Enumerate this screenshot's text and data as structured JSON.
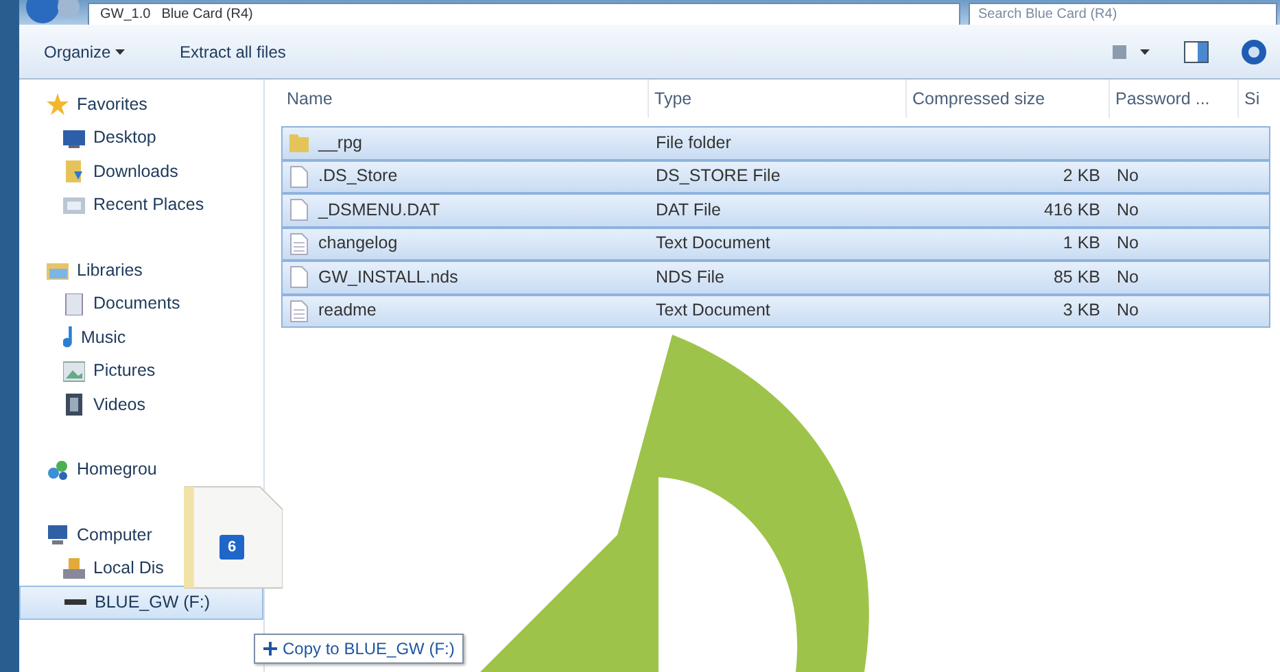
{
  "address_bar": {
    "crumbs": [
      "GW_1.0",
      "Blue Card (R4)"
    ],
    "search_placeholder": "Search Blue Card (R4)"
  },
  "toolbar": {
    "buttons": [
      {
        "label": "Organize",
        "dropdown": true
      },
      {
        "label": "Extract all files",
        "dropdown": false
      }
    ]
  },
  "sidebar": {
    "groups": [
      {
        "label": "Favorites",
        "selected": false,
        "children": [
          {
            "label": "Desktop",
            "selected": false
          },
          {
            "label": "Downloads",
            "selected": false
          },
          {
            "label": "Recent Places",
            "selected": false
          }
        ]
      },
      {
        "label": "Libraries",
        "selected": false,
        "children": [
          {
            "label": "Documents",
            "selected": false
          },
          {
            "label": "Music",
            "selected": false
          },
          {
            "label": "Pictures",
            "selected": false
          },
          {
            "label": "Videos",
            "selected": false
          }
        ]
      },
      {
        "label": "Homegrou",
        "selected": false
      },
      {
        "label": "Computer",
        "selected": false,
        "children": [
          {
            "label": "Local Dis",
            "selected": false
          },
          {
            "label": "BLUE_GW (F:)",
            "selected": true
          }
        ]
      }
    ]
  },
  "table": {
    "columns": [
      "Name",
      "Type",
      "Compressed size",
      "Password ...",
      "Si"
    ],
    "rows": [
      {
        "name": "__rpg",
        "kind": "folder",
        "type": "File folder",
        "selected": true
      },
      {
        "name": ".DS_Store",
        "kind": "file",
        "type": "DS_STORE File",
        "size": "2 KB",
        "password": "No",
        "selected": true
      },
      {
        "name": "_DSMENU.DAT",
        "kind": "file",
        "type": "DAT File",
        "size": "416 KB",
        "password": "No",
        "selected": true
      },
      {
        "name": "changelog",
        "kind": "text",
        "type": "Text Document",
        "size": "1 KB",
        "password": "No",
        "selected": true
      },
      {
        "name": "GW_INSTALL.nds",
        "kind": "file",
        "type": "NDS File",
        "size": "85 KB",
        "password": "No",
        "selected": true
      },
      {
        "name": "readme",
        "kind": "text",
        "type": "Text Document",
        "size": "3 KB",
        "password": "No",
        "selected": true
      }
    ]
  },
  "drag": {
    "count": "6",
    "tooltip": "Copy to BLUE_GW (F:)"
  }
}
